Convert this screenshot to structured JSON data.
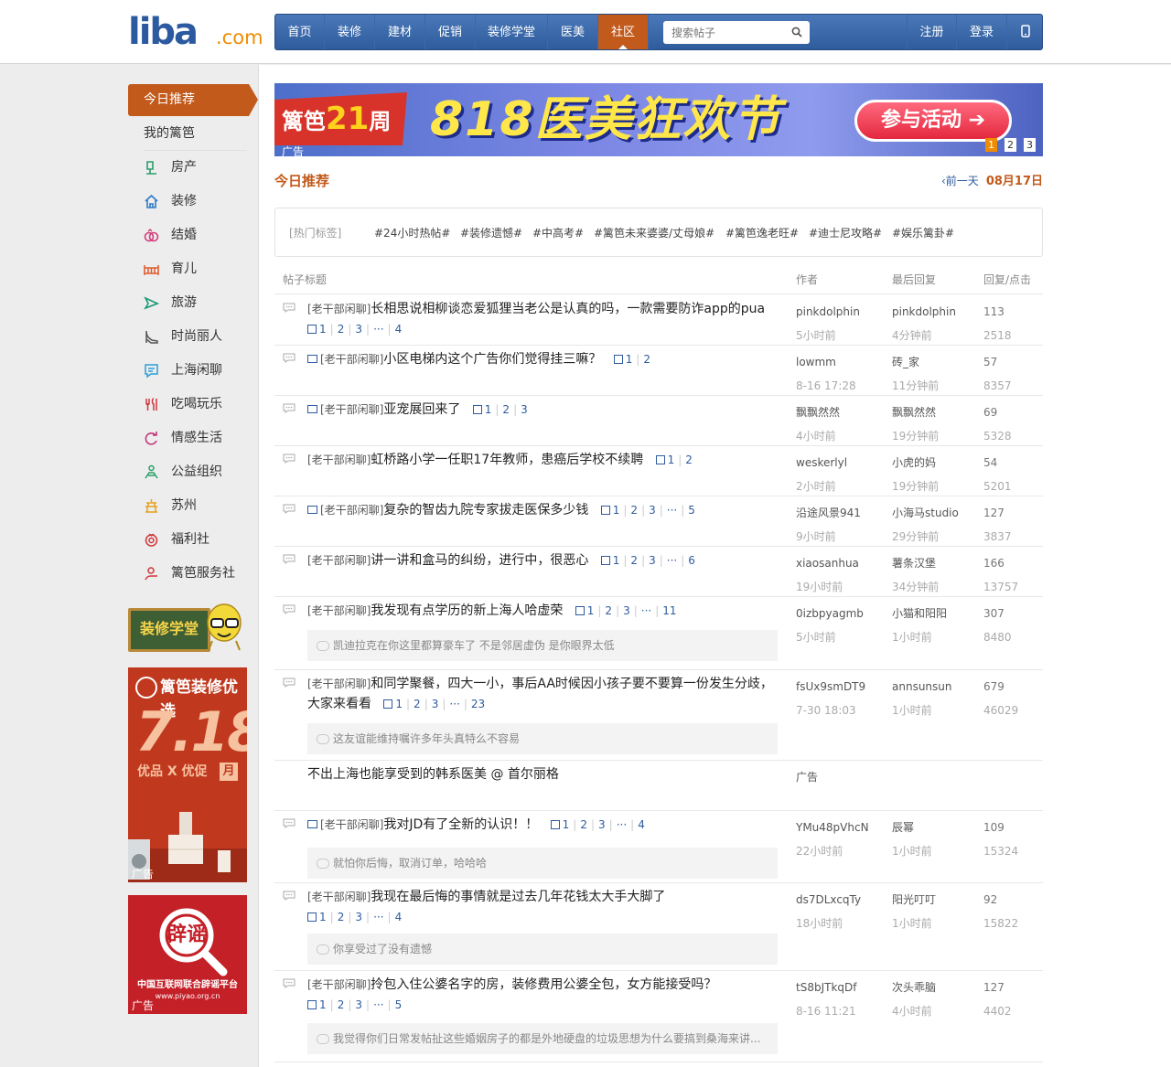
{
  "header": {
    "logo": {
      "main": "liba",
      "suffix": ".com"
    },
    "nav": [
      {
        "label": "首页"
      },
      {
        "label": "装修"
      },
      {
        "label": "建材"
      },
      {
        "label": "促销"
      },
      {
        "label": "装修学堂"
      },
      {
        "label": "医美"
      },
      {
        "label": "社区",
        "active": true
      }
    ],
    "search": {
      "placeholder": "搜索帖子"
    },
    "register": "注册",
    "login": "登录",
    "mobile_icon": "mobile-icon"
  },
  "sidebar": {
    "active": "今日推荐",
    "mine": "我的篱笆",
    "items": [
      {
        "label": "房产",
        "icon": "house-key-icon"
      },
      {
        "label": "装修",
        "icon": "home-icon"
      },
      {
        "label": "结婚",
        "icon": "rings-icon"
      },
      {
        "label": "育儿",
        "icon": "crib-icon"
      },
      {
        "label": "旅游",
        "icon": "plane-icon"
      },
      {
        "label": "时尚丽人",
        "icon": "heel-icon"
      },
      {
        "label": "上海闲聊",
        "icon": "chat-icon"
      },
      {
        "label": "吃喝玩乐",
        "icon": "fork-icon"
      },
      {
        "label": "情感生活",
        "icon": "arrow-loop-icon"
      },
      {
        "label": "公益组织",
        "icon": "hands-icon"
      },
      {
        "label": "苏州",
        "icon": "pagoda-icon"
      },
      {
        "label": "福利社",
        "icon": "gift-icon"
      },
      {
        "label": "篱笆服务社",
        "icon": "service-icon"
      }
    ],
    "xuetang_label": "装修学堂",
    "ad1": {
      "brand": "篱笆装修优选",
      "date": "7.18",
      "sub": "优品 X 优促",
      "month": "月",
      "tag": "广告"
    },
    "ad2": {
      "seal": "辟谣",
      "text": "中国互联网联合辟谣平台",
      "url": "www.piyao.org.cn",
      "tag": "广告"
    }
  },
  "banner": {
    "left": "篱笆",
    "anniversary": "21",
    "anniv_suffix": "周年",
    "title": "818医美狂欢节",
    "button": "参与活动",
    "pages": [
      "1",
      "2",
      "3"
    ],
    "tag": "广告"
  },
  "section": {
    "title": "今日推荐",
    "prev": "前一天",
    "date": "08月17日"
  },
  "tags": {
    "label": "[热门标签]",
    "items": [
      "#24小时热帖#",
      "#装修遗憾#",
      "#中高考#",
      "#篱笆未来婆婆/丈母娘#",
      "#篱笆逸老旺#",
      "#迪士尼攻略#",
      "#娱乐篱卦#"
    ]
  },
  "table": {
    "headers": {
      "title": "帖子标题",
      "author": "作者",
      "last": "最后回复",
      "stats": "回复/点击"
    },
    "rows": [
      {
        "cat": "[老干部闲聊]",
        "title": "长相思说相柳谈恋爱狐狸当老公是认真的吗，一款需要防诈app的pua",
        "pic": false,
        "pages": [
          "1",
          "2",
          "3",
          "···",
          "4"
        ],
        "pages_newline": true,
        "author": "pinkdolphin",
        "time": "5小时前",
        "last": "pinkdolphin",
        "last_time": "4分钟前",
        "replies": "113",
        "clicks": "2518"
      },
      {
        "cat": "[老干部闲聊]",
        "title": "小区电梯内这个广告你们觉得挂三嘛？",
        "pic": true,
        "pages": [
          "1",
          "2"
        ],
        "author": "lowmm",
        "time": "8-16 17:28",
        "last": "砖_家",
        "last_time": "11分钟前",
        "replies": "57",
        "clicks": "8357"
      },
      {
        "cat": "[老干部闲聊]",
        "title": "亚宠展回来了",
        "pic": true,
        "pages": [
          "1",
          "2",
          "3"
        ],
        "author": "飘飘然然",
        "time": "4小时前",
        "last": "飘飘然然",
        "last_time": "19分钟前",
        "replies": "69",
        "clicks": "5328"
      },
      {
        "cat": "[老干部闲聊]",
        "title": "虹桥路小学一任职17年教师，患癌后学校不续聘",
        "pic": false,
        "pages": [
          "1",
          "2"
        ],
        "author": "weskerlyl",
        "time": "2小时前",
        "last": "小虎的妈",
        "last_time": "19分钟前",
        "replies": "54",
        "clicks": "5201"
      },
      {
        "cat": "[老干部闲聊]",
        "title": "复杂的智齿九院专家拔走医保多少钱",
        "pic": true,
        "pages": [
          "1",
          "2",
          "3",
          "···",
          "5"
        ],
        "author": "沿途风景941",
        "time": "9小时前",
        "last": "小海马studio",
        "last_time": "29分钟前",
        "replies": "127",
        "clicks": "3837"
      },
      {
        "cat": "[老干部闲聊]",
        "title": "讲一讲和盒马的纠纷，进行中，很恶心",
        "pic": false,
        "pages": [
          "1",
          "2",
          "3",
          "···",
          "6"
        ],
        "author": "xiaosanhua",
        "time": "19小时前",
        "last": "薯条汉堡",
        "last_time": "34分钟前",
        "replies": "166",
        "clicks": "13757"
      },
      {
        "cat": "[老干部闲聊]",
        "title": "我发现有点学历的新上海人哈虚荣",
        "pic": false,
        "pages": [
          "1",
          "2",
          "3",
          "···",
          "11"
        ],
        "author": "0izbpyagmb",
        "time": "5小时前",
        "last": "小猫和阳阳",
        "last_time": "1小时前",
        "replies": "307",
        "clicks": "8480",
        "comment": "凯迪拉克在你这里都算豪车了 不是邻居虚伪 是你眼界太低"
      },
      {
        "cat": "[老干部闲聊]",
        "title": "和同学聚餐，四大一小，事后AA时候因小孩子要不要算一份发生分歧，大家来看看",
        "pic": false,
        "pages": [
          "1",
          "2",
          "3",
          "···",
          "23"
        ],
        "author": "fsUx9smDT9",
        "time": "7-30 18:03",
        "last": "annsunsun",
        "last_time": "1小时前",
        "replies": "679",
        "clicks": "46029",
        "comment": "这友谊能维持嘱许多年头真特么不容易"
      },
      {
        "ad": true,
        "title": "不出上海也能享受到的韩系医美 @ 首尔丽格",
        "author": "广告"
      },
      {
        "cat": "[老干部闲聊]",
        "title": "我对JD有了全新的认识！！",
        "pic": true,
        "pages": [
          "1",
          "2",
          "3",
          "···",
          "4"
        ],
        "author": "YMu48pVhcN",
        "time": "22小时前",
        "last": "辰幂",
        "last_time": "1小时前",
        "replies": "109",
        "clicks": "15324",
        "comment": "就怕你后悔，取消订单，哈哈哈"
      },
      {
        "cat": "[老干部闲聊]",
        "title": "我现在最后悔的事情就是过去几年花钱太大手大脚了",
        "pic": false,
        "pages": [
          "1",
          "2",
          "3",
          "···",
          "4"
        ],
        "pages_newline": true,
        "author": "ds7DLxcqTy",
        "time": "18小时前",
        "last": "阳光叮叮",
        "last_time": "1小时前",
        "replies": "92",
        "clicks": "15822",
        "comment": "你享受过了没有遗憾"
      },
      {
        "cat": "[老干部闲聊]",
        "title": "拎包入住公婆名字的房，装修费用公婆全包，女方能接受吗？",
        "pic": false,
        "pages": [
          "1",
          "2",
          "3",
          "···",
          "5"
        ],
        "pages_newline": true,
        "author": "tS8bJTkqDf",
        "time": "8-16 11:21",
        "last": "次头乖脑",
        "last_time": "4小时前",
        "replies": "127",
        "clicks": "4402",
        "comment": "我觉得你们日常发帖扯这些婚姻房子的都是外地硬盘的垃圾思想为什么要搞到桑海来讲..."
      }
    ]
  }
}
